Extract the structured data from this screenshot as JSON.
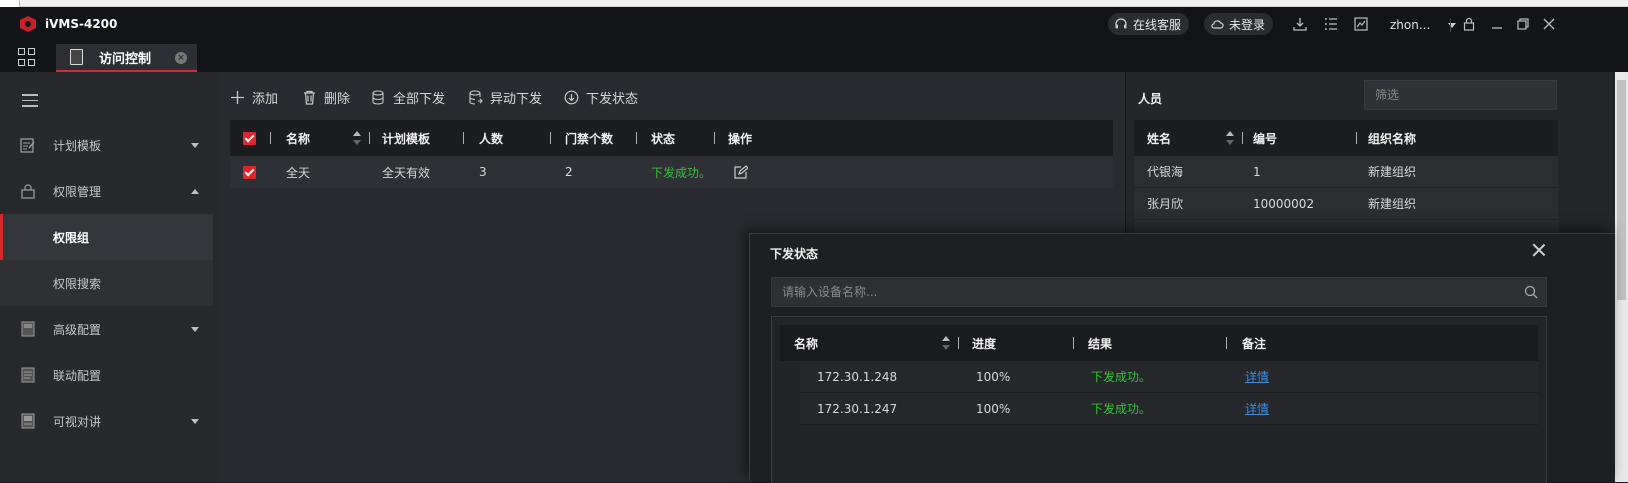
{
  "app": {
    "title": "iVMS-4200"
  },
  "topbar": {
    "support_label": "在线客服",
    "login_label": "未登录",
    "user_name": "zhon..."
  },
  "tabs": [
    {
      "label": "访问控制"
    }
  ],
  "sidebar": {
    "items": [
      {
        "label": "计划模板",
        "icon": "calendar-edit-icon"
      },
      {
        "label": "权限管理",
        "icon": "lock-icon"
      },
      {
        "label": "权限组"
      },
      {
        "label": "权限搜索"
      },
      {
        "label": "高级配置",
        "icon": "settings-icon"
      },
      {
        "label": "联动配置",
        "icon": "link-config-icon"
      },
      {
        "label": "可视对讲",
        "icon": "intercom-icon"
      }
    ]
  },
  "toolbar": {
    "add_label": "添加",
    "delete_label": "删除",
    "push_all_label": "全部下发",
    "push_changed_label": "异动下发",
    "push_status_label": "下发状态"
  },
  "group_table": {
    "columns": [
      "名称",
      "计划模板",
      "人数",
      "门禁个数",
      "状态",
      "操作"
    ],
    "rows": [
      {
        "name": "全天",
        "template": "全天有效",
        "people": "3",
        "doors": "2",
        "status": "下发成功。"
      }
    ]
  },
  "people_panel": {
    "title": "人员",
    "filter_placeholder": "筛选",
    "columns": [
      "姓名",
      "编号",
      "组织名称"
    ],
    "rows": [
      {
        "name": "代银海",
        "id": "1",
        "org": "新建组织"
      },
      {
        "name": "张月欣",
        "id": "10000002",
        "org": "新建组织"
      }
    ]
  },
  "dialog": {
    "title": "下发状态",
    "search_placeholder": "请输入设备名称...",
    "columns": [
      "名称",
      "进度",
      "结果",
      "备注"
    ],
    "rows": [
      {
        "name": "172.30.1.248",
        "progress": "100%",
        "result": "下发成功。",
        "note": "详情"
      },
      {
        "name": "172.30.1.247",
        "progress": "100%",
        "result": "下发成功。",
        "note": "详情"
      }
    ]
  },
  "colors": {
    "accent": "#d9272e",
    "success": "#35c13b",
    "link": "#3d8be0"
  }
}
